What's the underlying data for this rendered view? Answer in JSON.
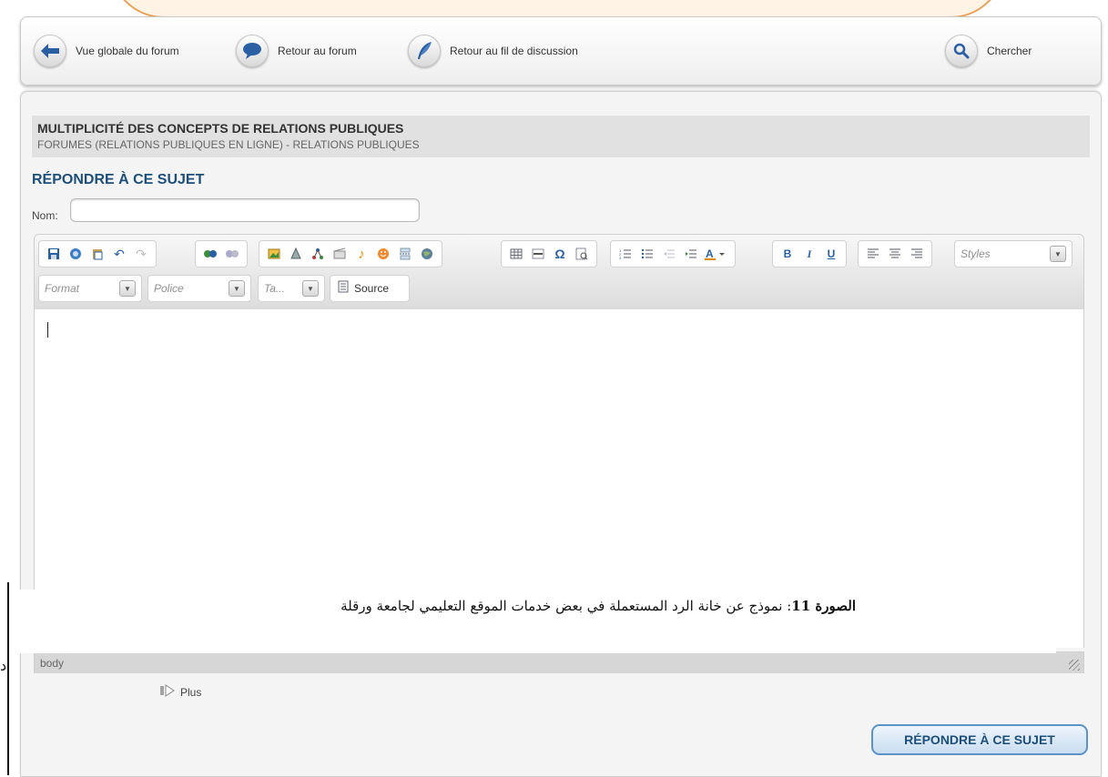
{
  "nav": {
    "overview_label": "Vue globale du forum",
    "forum_label": "Retour au forum",
    "thread_label": "Retour au fil de discussion",
    "search_label": "Chercher"
  },
  "topic": {
    "title": "MULTIPLICITÉ DES CONCEPTS DE RELATIONS PUBLIQUES",
    "breadcrumb": "FORUMES (RELATIONS PUBLIQUES EN LIGNE) - RELATIONS PUBLIQUES"
  },
  "form": {
    "heading": "RÉPONDRE À CE SUJET",
    "name_label": "Nom:",
    "name_value": ""
  },
  "editor": {
    "styles_combo": "Styles",
    "format_combo": "Format",
    "font_combo": "Police",
    "size_combo": "Ta...",
    "source_button": "Source",
    "status_path": "body",
    "icons": [
      "save",
      "preview",
      "paste-word",
      "undo",
      "redo",
      "link",
      "unlink",
      "image",
      "flash",
      "smiley",
      "special-char",
      "table",
      "horizontal-rule",
      "omega",
      "find",
      "numbered-list",
      "bulleted-list",
      "outdent",
      "indent",
      "font-color",
      "bold",
      "italic",
      "underline",
      "align-left",
      "align-center",
      "align-right"
    ]
  },
  "caption": {
    "label": "الصورة 11",
    "text": ": نموذج عن خانة الرد المستعملة في بعض خدمات الموقع التعليمي لجامعة ورقلة"
  },
  "more_label": "Plus",
  "submit_label": "RÉPONDRE À CE SUJET",
  "side_glyph": "د",
  "colors": {
    "accent": "#1d4f7a",
    "button_border": "#5b93c8",
    "nav_icon_blue": "#2a5fa3"
  }
}
